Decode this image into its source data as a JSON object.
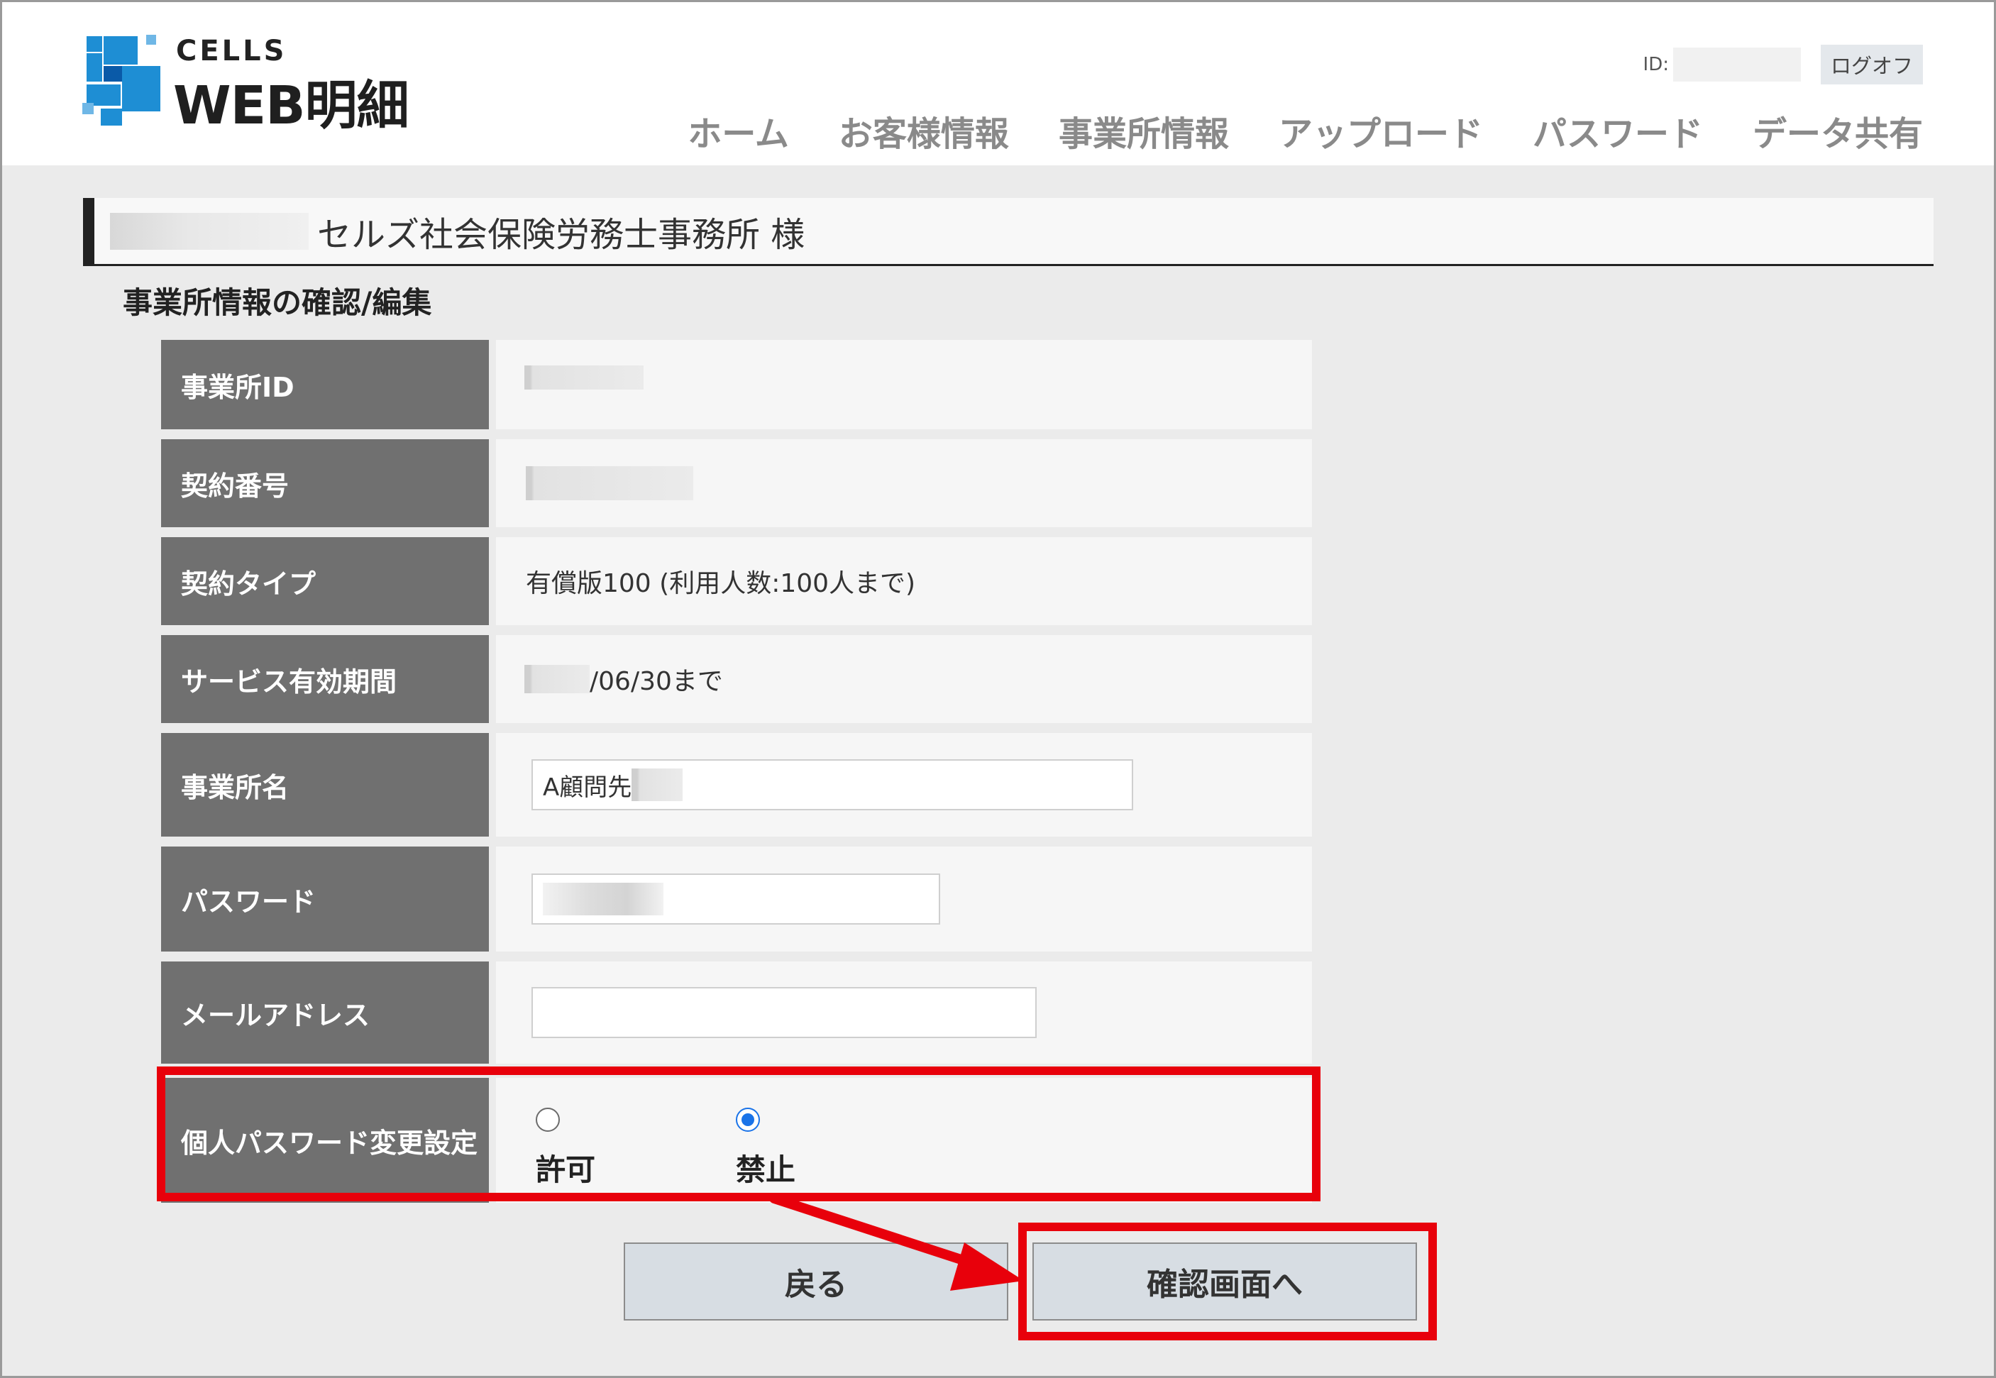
{
  "header": {
    "logo_small": "CELLS",
    "logo_main": "WEB明細",
    "id_label": "ID:",
    "logoff_label": "ログオフ",
    "nav": [
      "ホーム",
      "お客様情報",
      "事業所情報",
      "アップロード",
      "パスワード",
      "データ共有"
    ]
  },
  "client": {
    "name": "セルズ社会保険労務士事務所 様"
  },
  "page": {
    "section_title": "事業所情報の確認/編集"
  },
  "form": {
    "office_id_label": "事業所ID",
    "contract_no_label": "契約番号",
    "contract_type_label": "契約タイプ",
    "contract_type_value": "有償版100 (利用人数:100人まで)",
    "service_period_label": "サービス有効期間",
    "service_period_value": "/06/30まで",
    "office_name_label": "事業所名",
    "office_name_value": "A顧問先",
    "password_label": "パスワード",
    "email_label": "メールアドレス",
    "pw_change_label": "個人パスワード変更設定",
    "pw_change_options": [
      "許可",
      "禁止"
    ],
    "pw_change_selected": "禁止"
  },
  "buttons": {
    "back": "戻る",
    "confirm": "確認画面へ"
  },
  "colors": {
    "highlight": "#e8000b",
    "label_bg": "#707070",
    "radio_accent": "#1a73e8"
  }
}
